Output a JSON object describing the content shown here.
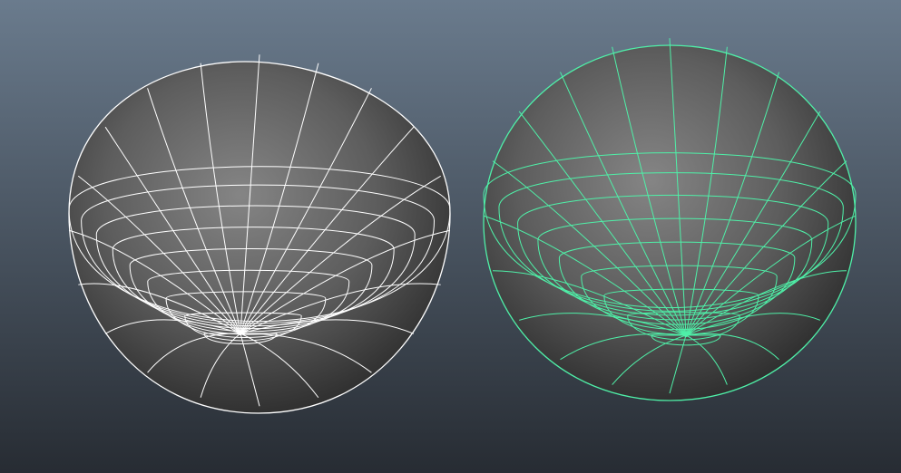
{
  "viewport": {
    "background_top": "#6a7b8d",
    "background_bottom": "#272c33",
    "shade_light": "#858585",
    "shade_mid": "#5d5d5d",
    "shade_dark": "#2c2c2c"
  },
  "objects": [
    {
      "name": "sphere-left",
      "state": "unselected",
      "wireframe_color": "#ffffff",
      "meridians": 20,
      "rings": 9
    },
    {
      "name": "sphere-right",
      "state": "selected",
      "wireframe_color": "#4ff0a8",
      "meridians": 20,
      "rings": 9
    }
  ]
}
